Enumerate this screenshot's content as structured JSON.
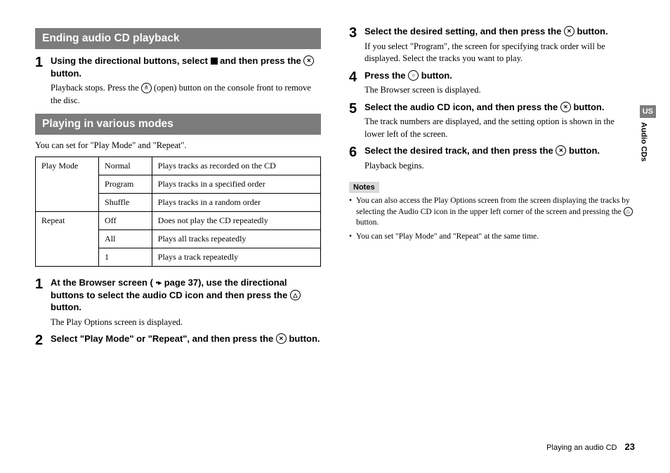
{
  "left": {
    "sec1_title": "Ending audio CD playback",
    "sec1_step1_head_a": "Using the directional buttons, select ",
    "sec1_step1_head_b": " and then press the ",
    "sec1_step1_head_c": " button.",
    "sec1_step1_text_a": "Playback stops. Press the ",
    "sec1_step1_text_b": " (open) button on the console front to remove the disc.",
    "sec2_title": "Playing in various modes",
    "sec2_intro": "You can set for \"Play Mode\" and \"Repeat\".",
    "table": {
      "r1c1": "Play Mode",
      "r1c2": "Normal",
      "r1c3": "Plays tracks as recorded on the CD",
      "r2c2": "Program",
      "r2c3": "Plays tracks in a specified order",
      "r3c2": "Shuffle",
      "r3c3": "Plays tracks in a random order",
      "r4c1": "Repeat",
      "r4c2": "Off",
      "r4c3": "Does not play the CD repeatedly",
      "r5c2": "All",
      "r5c3": "Plays all tracks repeatedly",
      "r6c2": "1",
      "r6c3": "Plays a track repeatedly"
    },
    "step1_head_a": "At the Browser screen (",
    "step1_head_b": " page 37), use the directional buttons to select the audio CD icon and then press the ",
    "step1_head_c": " button.",
    "step1_text": "The Play Options screen is displayed.",
    "step2_head_a": "Select \"Play Mode\" or \"Repeat\", and then press the ",
    "step2_head_b": " button."
  },
  "right": {
    "step3_head_a": "Select the desired setting, and then press the ",
    "step3_head_b": " button.",
    "step3_text": "If you select \"Program\", the screen for specifying track order will be displayed. Select the tracks you want to play.",
    "step4_head_a": "Press the ",
    "step4_head_b": " button.",
    "step4_text": "The Browser screen is displayed.",
    "step5_head_a": "Select the audio CD icon, and then press the ",
    "step5_head_b": " button.",
    "step5_text": "The track numbers are displayed, and the setting option is shown in the lower left of the screen.",
    "step6_head_a": "Select the desired track, and then press the ",
    "step6_head_b": " button.",
    "step6_text": "Playback begins.",
    "notes_label": "Notes",
    "note1_a": "You can also access the Play Options screen from the screen displaying the tracks by selecting the Audio CD icon in the upper left corner of the screen and pressing the ",
    "note1_b": " button.",
    "note2": "You can set \"Play Mode\" and \"Repeat\" at the same time."
  },
  "side": {
    "lang": "US",
    "section": "Audio CDs"
  },
  "footer": {
    "title": "Playing an audio CD",
    "page": "23"
  },
  "icons": {
    "x": "✕",
    "o": "○",
    "tri": "△",
    "eject": "≜",
    "arrow": "•▸"
  }
}
